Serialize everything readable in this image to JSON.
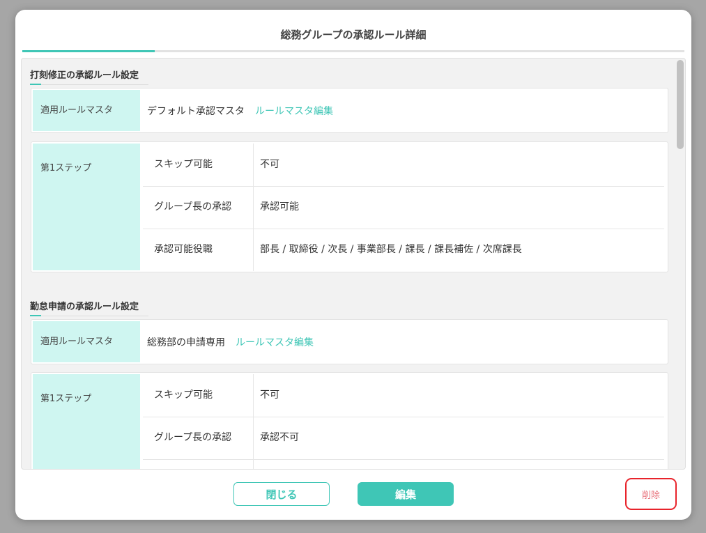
{
  "modal": {
    "title": "総務グループの承認ルール詳細"
  },
  "sections": [
    {
      "title": "打刻修正の承認ルール設定",
      "master": {
        "label": "適用ルールマスタ",
        "value": "デフォルト承認マスタ",
        "link": "ルールマスタ編集"
      },
      "step": {
        "label": "第1ステップ",
        "rows": [
          {
            "key": "スキップ可能",
            "value": "不可"
          },
          {
            "key": "グループ長の承認",
            "value": "承認可能"
          },
          {
            "key": "承認可能役職",
            "value": "部長 / 取締役 / 次長 / 事業部長 / 課長 / 課長補佐 / 次席課長"
          }
        ]
      }
    },
    {
      "title": "勤怠申請の承認ルール設定",
      "master": {
        "label": "適用ルールマスタ",
        "value": "総務部の申請専用",
        "link": "ルールマスタ編集"
      },
      "step": {
        "label": "第1ステップ",
        "rows": [
          {
            "key": "スキップ可能",
            "value": "不可"
          },
          {
            "key": "グループ長の承認",
            "value": "承認不可"
          }
        ]
      }
    }
  ],
  "footer": {
    "close_label": "閉じる",
    "edit_label": "編集",
    "delete_label": "削除"
  },
  "colors": {
    "accent": "#3fc6b6",
    "label_bg": "#cff6f1",
    "delete_highlight": "#e8232b"
  }
}
